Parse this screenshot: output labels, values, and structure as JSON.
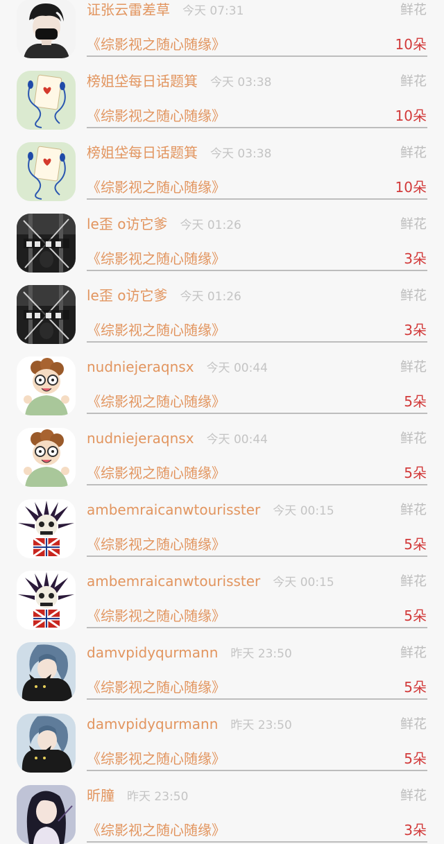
{
  "gift_list": {
    "items": [
      {
        "avatar": "masked-boy-avatar",
        "name": "证张云雷差草",
        "time": "今天 07:31",
        "gift": "鲜花",
        "book": "《综影视之随心随缘》",
        "count": "10朵"
      },
      {
        "avatar": "playing-card-earphones-avatar",
        "name": "榜姐垈每日话题箕",
        "time": "今天 03:38",
        "gift": "鲜花",
        "book": "《综影视之随心随缘》",
        "count": "10朵"
      },
      {
        "avatar": "playing-card-earphones-avatar",
        "name": "榜姐垈每日话题箕",
        "time": "今天 03:38",
        "gift": "鲜花",
        "book": "《综影视之随心随缘》",
        "count": "10朵"
      },
      {
        "avatar": "dark-calligraphy-avatar",
        "name": "le歪 o访它爹",
        "time": "今天 01:26",
        "gift": "鲜花",
        "book": "《综影视之随心随缘》",
        "count": "3朵"
      },
      {
        "avatar": "dark-calligraphy-avatar",
        "name": "le歪 o访它爹",
        "time": "今天 01:26",
        "gift": "鲜花",
        "book": "《综影视之随心随缘》",
        "count": "3朵"
      },
      {
        "avatar": "cartoon-boy-glasses-avatar",
        "name": "nudniejeraqnsx",
        "time": "今天 00:44",
        "gift": "鲜花",
        "book": "《综影视之随心随缘》",
        "count": "5朵"
      },
      {
        "avatar": "cartoon-boy-glasses-avatar",
        "name": "nudniejeraqnsx",
        "time": "今天 00:44",
        "gift": "鲜花",
        "book": "《综影视之随心随缘》",
        "count": "5朵"
      },
      {
        "avatar": "punk-skull-avatar",
        "name": "ambemraicanwtourisster",
        "time": "今天 00:15",
        "gift": "鲜花",
        "book": "《综影视之随心随缘》",
        "count": "5朵"
      },
      {
        "avatar": "punk-skull-avatar",
        "name": "ambemraicanwtourisster",
        "time": "今天 00:15",
        "gift": "鲜花",
        "book": "《综影视之随心随缘》",
        "count": "5朵"
      },
      {
        "avatar": "anime-boy-black-cat-avatar",
        "name": "damvpidyqurmann",
        "time": "昨天 23:50",
        "gift": "鲜花",
        "book": "《综影视之随心随缘》",
        "count": "5朵"
      },
      {
        "avatar": "anime-boy-black-cat-avatar",
        "name": "damvpidyqurmann",
        "time": "昨天 23:50",
        "gift": "鲜花",
        "book": "《综影视之随心随缘》",
        "count": "5朵"
      },
      {
        "avatar": "anime-girl-avatar",
        "name": "昕朣",
        "time": "昨天 23:50",
        "gift": "鲜花",
        "book": "《综影视之随心随缘》",
        "count": "3朵"
      }
    ]
  }
}
